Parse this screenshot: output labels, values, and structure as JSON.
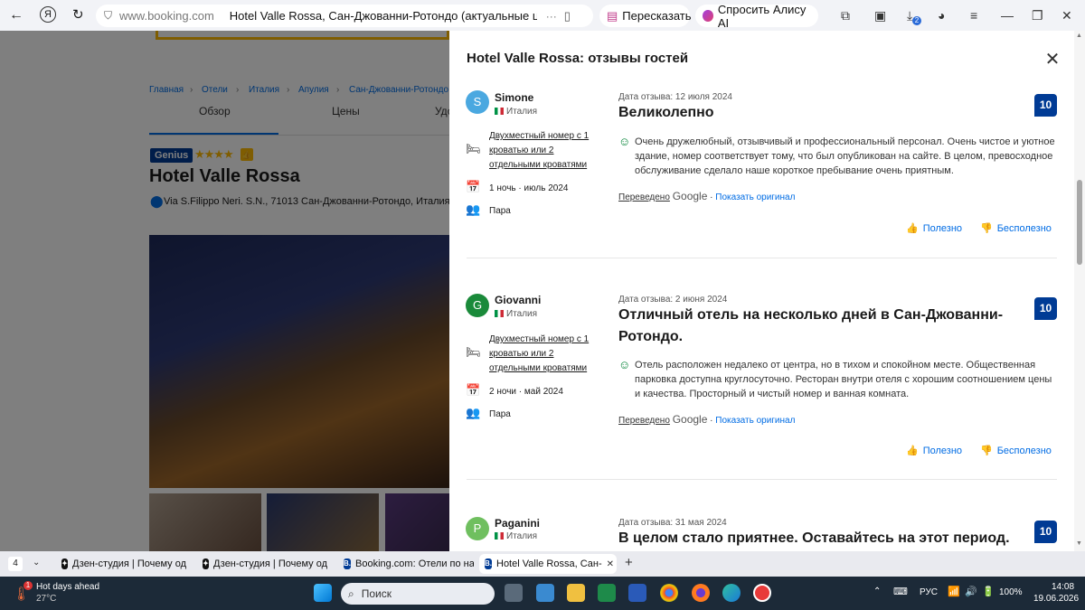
{
  "browser": {
    "domain": "www.booking.com",
    "page_title": "Hotel Valle Rossa, Сан-Джованни-Ротондо (актуальные цен...",
    "retell_label": "Пересказать",
    "alice_label": "Спросить Алису AI",
    "downloads_badge": "2"
  },
  "page": {
    "breadcrumb": [
      "Главная",
      "Отели",
      "Италия",
      "Апулия",
      "Сан-Джованни-Ротондо"
    ],
    "tabs": [
      "Обзор",
      "Цены",
      "Удо"
    ],
    "genius": "Genius",
    "hotel_name": "Hotel Valle Rossa",
    "address": "Via S.Filippo Neri. S.N., 71013 Сан-Джованни-Ротондо, Италия –"
  },
  "modal": {
    "title": "Hotel Valle Rossa: отзывы гостей",
    "reviews": [
      {
        "initial": "S",
        "name": "Simone",
        "country": "Италия",
        "avatar_color": "#4aa8e0",
        "room": "Двухместный номер с 1 кроватью или 2 отдельными кроватями",
        "stay": "1 ночь · июль 2024",
        "traveler": "Пара",
        "date": "Дата отзыва: 12 июля 2024",
        "title": "Великолепно",
        "score": "10",
        "text": "Очень дружелюбный, отзывчивый и профессиональный персонал. Очень чистое и уютное здание, номер соответствует тому, что был опубликован на сайте. В целом, превосходное обслуживание сделало наше короткое пребывание очень приятным.",
        "translated": "Переведено",
        "google": "Google",
        "show_original": "Показать оригинал",
        "helpful": "Полезно",
        "unhelpful": "Бесполезно"
      },
      {
        "initial": "G",
        "name": "Giovanni",
        "country": "Италия",
        "avatar_color": "#1a8a3a",
        "room": "Двухместный номер с 1 кроватью или 2 отдельными кроватями",
        "stay": "2 ночи · май 2024",
        "traveler": "Пара",
        "date": "Дата отзыва: 2 июня 2024",
        "title": "Отличный отель на несколько дней в Сан-Джованни-Ротондо.",
        "score": "10",
        "text": "Отель расположен недалеко от центра, но в тихом и спокойном месте. Общественная парковка доступна круглосуточно. Ресторан внутри отеля с хорошим соотношением цены и качества. Просторный и чистый номер и ванная комната.",
        "translated": "Переведено",
        "google": "Google",
        "show_original": "Показать оригинал",
        "helpful": "Полезно",
        "unhelpful": "Бесполезно"
      },
      {
        "initial": "P",
        "name": "Paganini",
        "country": "Италия",
        "avatar_color": "#6fbf5f",
        "date": "Дата отзыва: 31 мая 2024",
        "title": "В целом стало приятнее. Оставайтесь на этот период.",
        "score": "10"
      }
    ]
  },
  "tabstrip": {
    "count": "4",
    "tabs": [
      "Дзен-студия | Почему од",
      "Дзен-студия | Почему од",
      "Booking.com: Отели по на",
      "Hotel Valle Rossa, Сан-"
    ]
  },
  "taskbar": {
    "weather_title": "Hot days ahead",
    "weather_temp": "27°C",
    "weather_badge": "1",
    "search_placeholder": "Поиск",
    "lang": "РУС",
    "battery": "100%",
    "time": "14:08",
    "date": "19.06.2026"
  }
}
